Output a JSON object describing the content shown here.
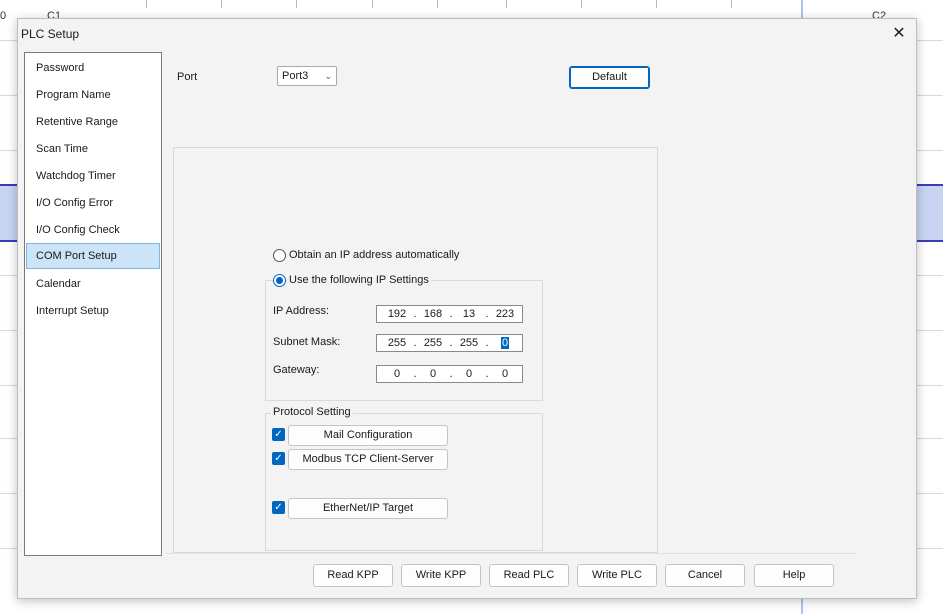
{
  "background": {
    "column_labels": [
      "C1",
      "C2"
    ],
    "left_label": "0"
  },
  "dialog": {
    "title": "PLC Setup",
    "close_glyph": "✕",
    "nav_items": [
      "Password",
      "Program Name",
      "Retentive Range",
      "Scan Time",
      "Watchdog Timer",
      "I/O Config Error",
      "I/O Config Check",
      "COM Port Setup",
      "Calendar",
      "Interrupt Setup"
    ],
    "selected_nav": "COM Port Setup",
    "port": {
      "label": "Port",
      "value": "Port3"
    },
    "default_button": "Default",
    "ip_mode": {
      "auto_label": "Obtain an IP address automatically",
      "auto_selected": false,
      "manual_label": "Use the following IP Settings",
      "manual_selected": true
    },
    "ip_settings": {
      "ip_label": "IP Address:",
      "ip": [
        "192",
        "168",
        "13",
        "223"
      ],
      "subnet_label": "Subnet Mask:",
      "subnet": [
        "255",
        "255",
        "255",
        "0"
      ],
      "gateway_label": "Gateway:",
      "gateway": [
        "0",
        "0",
        "0",
        "0"
      ]
    },
    "protocol": {
      "title": "Protocol Setting",
      "items": [
        {
          "label": "Mail Configuration",
          "checked": true
        },
        {
          "label": "Modbus TCP Client-Server",
          "checked": true
        },
        {
          "label": "EtherNet/IP Target",
          "checked": true
        }
      ]
    },
    "footer_buttons": [
      "Read KPP",
      "Write KPP",
      "Read PLC",
      "Write PLC",
      "Cancel",
      "Help"
    ],
    "colors": {
      "accent": "#0067c0",
      "selection_bg": "#cce4f7",
      "ladder_selection": "#c7d4f2"
    }
  }
}
